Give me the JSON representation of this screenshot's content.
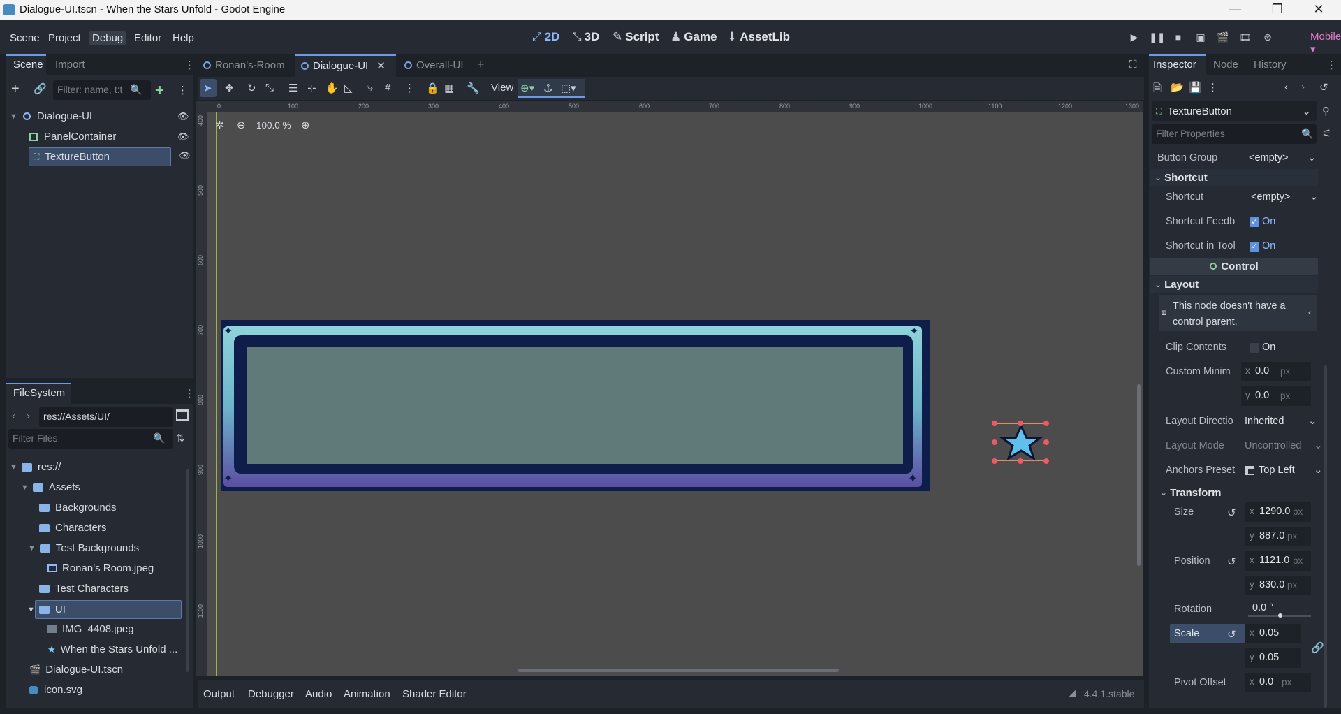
{
  "window": {
    "title": "Dialogue-UI.tscn - When the Stars Unfold - Godot Engine"
  },
  "menu": [
    "Scene",
    "Project",
    "Debug",
    "Editor",
    "Help"
  ],
  "workspaces": [
    "2D",
    "3D",
    "Script",
    "Game",
    "AssetLib"
  ],
  "renderer": "Mobile",
  "scene_panel": {
    "tabs": [
      "Scene",
      "Import"
    ],
    "filter_placeholder": "Filter: name, t:t",
    "nodes": [
      "Dialogue-UI",
      "PanelContainer",
      "TextureButton"
    ]
  },
  "filesystem": {
    "tab": "FileSystem",
    "path": "res://Assets/UI/",
    "filter_placeholder": "Filter Files",
    "items": [
      "res://",
      "Assets",
      "Backgrounds",
      "Characters",
      "Test Backgrounds",
      "Ronan's Room.jpeg",
      "Test Characters",
      "UI",
      "IMG_4408.jpeg",
      "When the Stars Unfold ...",
      "Dialogue-UI.tscn",
      "icon.svg"
    ]
  },
  "editor_tabs": [
    "Ronan's-Room",
    "Dialogue-UI",
    "Overall-UI"
  ],
  "toolbar": {
    "view": "View"
  },
  "zoom": "100.0 %",
  "ruler_h": [
    "0",
    "100",
    "200",
    "300",
    "400",
    "500",
    "600",
    "700",
    "800",
    "900",
    "1000",
    "1100",
    "1200",
    "1300"
  ],
  "ruler_v": [
    "400",
    "500",
    "600",
    "700",
    "800",
    "900",
    "1000",
    "1100"
  ],
  "bottom_tabs": [
    "Output",
    "Debugger",
    "Audio",
    "Animation",
    "Shader Editor"
  ],
  "version": "4.4.1.stable",
  "inspector": {
    "tabs": [
      "Inspector",
      "Node",
      "History"
    ],
    "node": "TextureButton",
    "filter_placeholder": "Filter Properties",
    "button_group": {
      "label": "Button Group",
      "value": "<empty>"
    },
    "shortcut_section": "Shortcut",
    "shortcut": {
      "label": "Shortcut",
      "value": "<empty>"
    },
    "shortcut_feedback": {
      "label": "Shortcut Feedb",
      "value": "On"
    },
    "shortcut_in_tooltip": {
      "label": "Shortcut in Tool",
      "value": "On"
    },
    "control": "Control",
    "layout_section": "Layout",
    "warning": "This node doesn't have a control parent.",
    "clip_contents": {
      "label": "Clip Contents",
      "value": "On"
    },
    "custom_min": {
      "label": "Custom Minim",
      "x": "0.0",
      "y": "0.0"
    },
    "layout_direction": {
      "label": "Layout Directio",
      "value": "Inherited"
    },
    "layout_mode": {
      "label": "Layout Mode",
      "value": "Uncontrolled"
    },
    "anchors_preset": {
      "label": "Anchors Preset",
      "value": "Top Left"
    },
    "transform_section": "Transform",
    "size": {
      "label": "Size",
      "x": "1290.0",
      "y": "887.0"
    },
    "position": {
      "label": "Position",
      "x": "1121.0",
      "y": "830.0"
    },
    "rotation": {
      "label": "Rotation",
      "value": "0.0 °"
    },
    "scale": {
      "label": "Scale",
      "x": "0.05",
      "y": "0.05"
    },
    "pivot": {
      "label": "Pivot Offset",
      "x": "0.0"
    },
    "unit": "px"
  }
}
